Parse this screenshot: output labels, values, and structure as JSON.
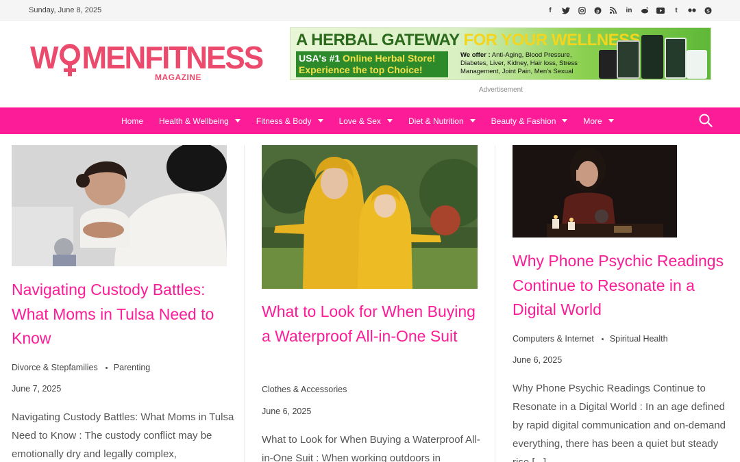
{
  "topbar": {
    "date": "Sunday, June 8, 2025",
    "social_icons": [
      "facebook-icon",
      "twitter-icon",
      "instagram-icon",
      "pinterest-icon",
      "rss-icon",
      "linkedin-icon",
      "reddit-icon",
      "youtube-icon",
      "tumblr-icon",
      "flickr-icon",
      "skype-icon"
    ]
  },
  "logo": {
    "text_before": "W",
    "text_after": "MENFITNESS",
    "sub": "MAGAZINE"
  },
  "ad": {
    "headline_a": "A HERBAL GATEWAY",
    "headline_b": "FOR YOUR WELLNESS",
    "line1_a": "USA's #1",
    "line1_b": "Online Herbal Store!",
    "line2": "Experience the top Choice!",
    "offer_label": "We offer :",
    "offer_text": "Anti-Aging, Blood Pressure, Diabetes, Liver, Kidney, Hair loss, Stress Management, Joint Pain, Men's Sexual",
    "label": "Advertisement"
  },
  "nav": {
    "items": [
      {
        "label": "Home",
        "dropdown": false
      },
      {
        "label": "Health & Wellbeing",
        "dropdown": true
      },
      {
        "label": "Fitness & Body",
        "dropdown": true
      },
      {
        "label": "Love & Sex",
        "dropdown": true
      },
      {
        "label": "Diet & Nutrition",
        "dropdown": true
      },
      {
        "label": "Beauty & Fashion",
        "dropdown": true
      },
      {
        "label": "More",
        "dropdown": true
      }
    ]
  },
  "articles": [
    {
      "title": "Navigating Custody Battles: What Moms in Tulsa Need to Know",
      "categories": [
        "Divorce & Stepfamilies",
        "Parenting"
      ],
      "date": "June 7, 2025",
      "excerpt": "Navigating Custody Battles: What Moms in Tulsa Need to Know : The custody conflict may be emotionally dry and legally complex,"
    },
    {
      "title": "What to Look for When Buying a Waterproof All-in-One Suit",
      "categories": [
        "Clothes & Accessories"
      ],
      "date": "June 6, 2025",
      "excerpt": "What to Look for When Buying a Waterproof All-in-One Suit : When working outdoors in"
    },
    {
      "title": "Why Phone Psychic Readings Continue to Resonate in a Digital World",
      "categories": [
        "Computers & Internet",
        "Spiritual Health"
      ],
      "date": "June 6, 2025",
      "excerpt": "Why Phone Psychic Readings Continue to Resonate in a Digital World : In an age defined by rapid digital communication and on-demand everything, there has been a quiet but steady rise [...]"
    }
  ],
  "colors": {
    "accent": "#fc1c97",
    "logo": "#ec4a6c"
  }
}
